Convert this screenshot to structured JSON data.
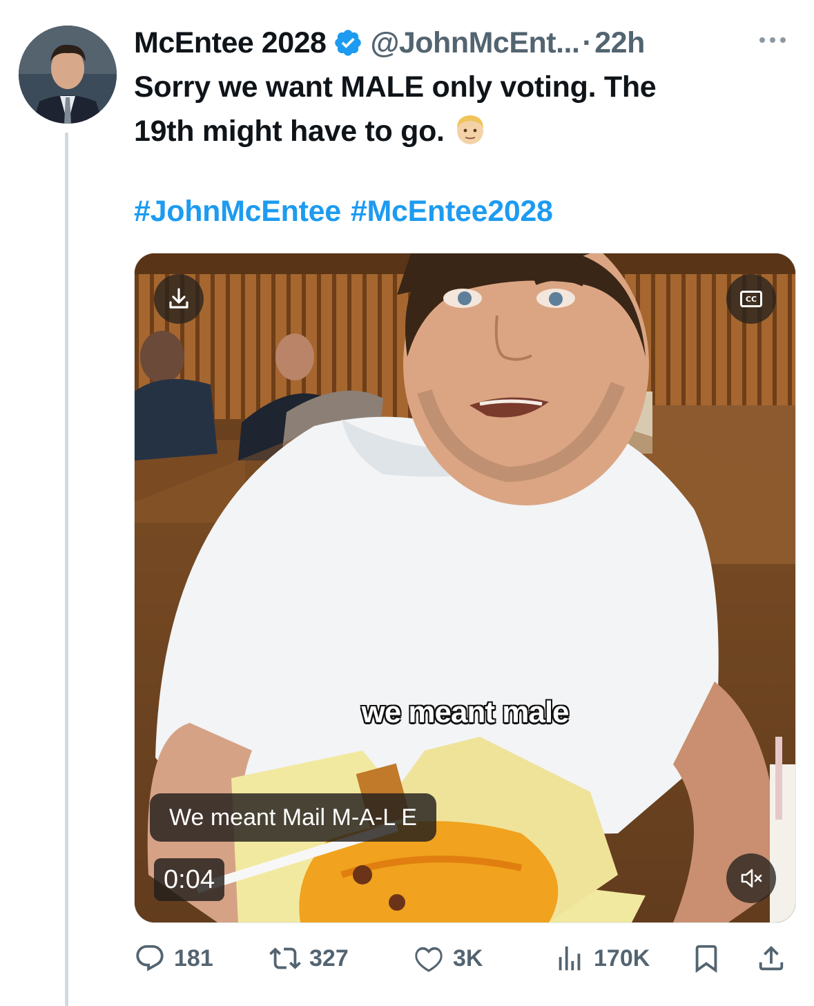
{
  "tweet": {
    "display_name": "McEntee 2028",
    "handle": "@JohnMcEnt...",
    "separator": "·",
    "time": "22h",
    "text_line1": "Sorry we want MALE only voting. The",
    "text_line2": "19th might have to go.",
    "emoji": "man-blond-hair-emoji",
    "hashtags": [
      "#JohnMcEntee",
      "#McEntee2028"
    ]
  },
  "video": {
    "burned_caption": "we meant male",
    "closed_caption": "We meant Mail M-A-L E",
    "timestamp": "0:04",
    "cc_label": "CC"
  },
  "actions": {
    "replies": "181",
    "reposts": "327",
    "likes": "3K",
    "views": "170K"
  },
  "colors": {
    "accent": "#1d9bf0",
    "secondary_text": "#536471",
    "thread_line": "#cfd9de"
  }
}
